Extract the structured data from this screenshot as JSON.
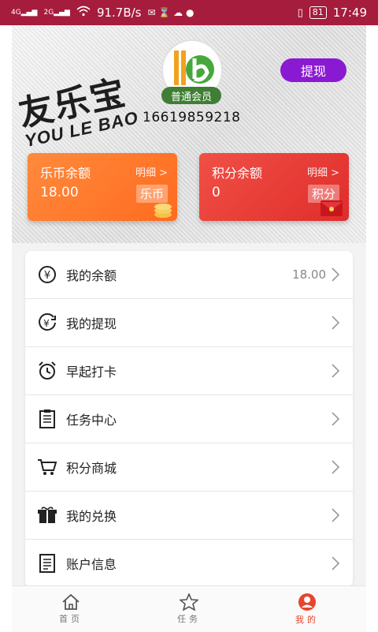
{
  "status_bar": {
    "signal_left": "4G",
    "signal_right": "2G",
    "speed": "91.7B/s",
    "battery": "81",
    "time": "17:49"
  },
  "header": {
    "brand_cn": "友乐宝",
    "brand_en": "YOU LE BAO",
    "member_level": "普通会员",
    "phone": "16619859218",
    "withdraw_label": "提现"
  },
  "cards": {
    "lebi": {
      "title": "乐币余额",
      "detail": "明细 >",
      "value": "18.00",
      "tag": "乐币"
    },
    "jifen": {
      "title": "积分余额",
      "detail": "明细 >",
      "value": "0",
      "tag": "积分"
    }
  },
  "menu": [
    {
      "label": "我的余额",
      "amount": "18.00",
      "icon": "yuan-circle-icon"
    },
    {
      "label": "我的提现",
      "amount": "",
      "icon": "withdraw-icon"
    },
    {
      "label": "早起打卡",
      "amount": "",
      "icon": "alarm-clock-icon"
    },
    {
      "label": "任务中心",
      "amount": "",
      "icon": "clipboard-icon"
    },
    {
      "label": "积分商城",
      "amount": "",
      "icon": "shopping-cart-icon"
    },
    {
      "label": "我的兑换",
      "amount": "",
      "icon": "gift-box-icon"
    },
    {
      "label": "账户信息",
      "amount": "",
      "icon": "document-icon"
    }
  ],
  "tabs": [
    {
      "label": "首页",
      "icon": "home-icon",
      "active": false
    },
    {
      "label": "任务",
      "icon": "star-icon",
      "active": false
    },
    {
      "label": "我的",
      "icon": "user-icon",
      "active": true
    }
  ],
  "colors": {
    "status_bar": "#a51c3d",
    "withdraw_button": "#8a1ad2",
    "lebi_card": "#ff7a2e",
    "jifen_card": "#e8372f",
    "tab_active": "#e8462c"
  }
}
